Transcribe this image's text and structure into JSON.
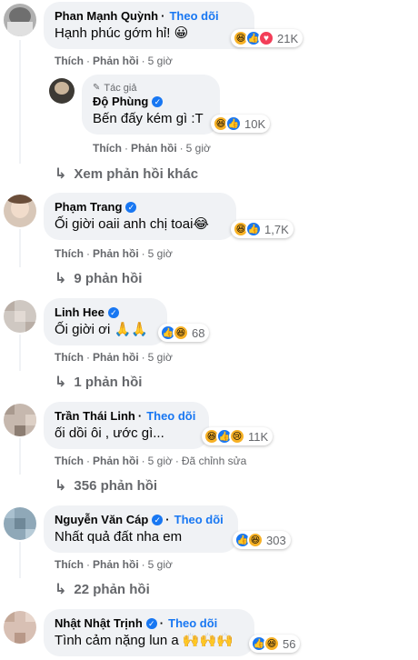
{
  "labels": {
    "like": "Thích",
    "reply": "Phản hồi",
    "follow": "Theo dõi",
    "author_tag": "Tác giả",
    "dot": "·"
  },
  "comments": [
    {
      "author": "Phan Mạnh Quỳnh",
      "verified": false,
      "follow": true,
      "text": "Hạnh phúc gớm hỉ! 😀",
      "reactions": [
        "haha",
        "like",
        "love"
      ],
      "count": "21K",
      "time": "5 giờ"
    },
    {
      "author": "Độ Phùng",
      "verified": true,
      "follow": false,
      "is_author": true,
      "text": "Bến đấy kém gì :T",
      "reactions": [
        "haha",
        "like"
      ],
      "count": "10K",
      "time": "5 giờ"
    },
    {
      "author": "Phạm Trang",
      "verified": true,
      "follow": false,
      "text": "Ối giời oaii anh chị toai😂",
      "reactions": [
        "haha",
        "like"
      ],
      "count": "1,7K",
      "time": "5 giờ",
      "replies": "9 phản hồi"
    },
    {
      "author": "Linh Hee",
      "verified": true,
      "follow": false,
      "text": "Ối giời ơi 🙏🙏",
      "reactions": [
        "like",
        "haha"
      ],
      "count": "68",
      "time": "5 giờ",
      "replies": "1 phản hồi"
    },
    {
      "author": "Trần Thái Linh",
      "verified": false,
      "follow": true,
      "text": "ối dồi ôi , ước gì...",
      "reactions": [
        "haha",
        "like",
        "sad"
      ],
      "count": "11K",
      "time": "5 giờ",
      "edited": "Đã chỉnh sửa",
      "replies": "356 phản hồi"
    },
    {
      "author": "Nguyễn Văn Cáp",
      "verified": true,
      "follow": true,
      "text": "Nhất quả đất nha em",
      "reactions": [
        "like",
        "haha"
      ],
      "count": "303",
      "time": "5 giờ",
      "replies": "22 phản hồi"
    },
    {
      "author": "Nhật Nhật Trịnh",
      "verified": true,
      "follow": true,
      "text": "Tình cảm nặng lun a 🙌🙌🙌",
      "reactions": [
        "like",
        "haha"
      ],
      "count": "56"
    }
  ],
  "more_replies": "Xem phản hồi khác",
  "icons": {
    "haha": "😆",
    "like": "👍",
    "love": "♥",
    "sad": "😢",
    "reply_arrow": "↳",
    "verified": "✓",
    "author_tag": "✎"
  }
}
